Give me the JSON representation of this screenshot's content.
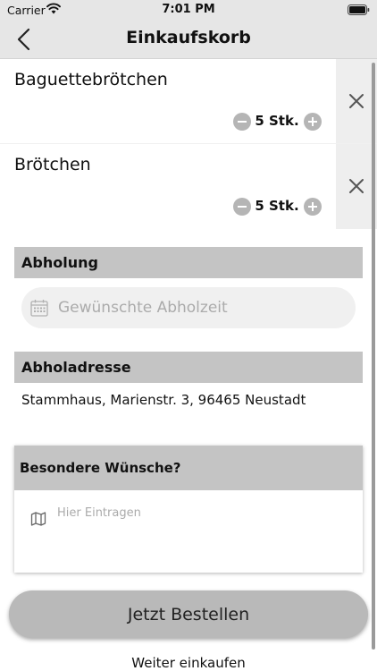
{
  "status_bar": {
    "carrier": "Carrier",
    "time": "7:01 PM"
  },
  "nav": {
    "title": "Einkaufskorb"
  },
  "cart": {
    "items": [
      {
        "name": "Baguettebrötchen",
        "quantity": "5 Stk."
      },
      {
        "name": "Brötchen",
        "quantity": "5 Stk."
      }
    ]
  },
  "pickup": {
    "header": "Abholung",
    "placeholder": "Gewünschte Abholzeit"
  },
  "address": {
    "header": "Abholadresse",
    "value": "Stammhaus, Marienstr. 3, 96465 Neustadt"
  },
  "wishes": {
    "header": "Besondere Wünsche?",
    "placeholder": "Hier Eintragen"
  },
  "actions": {
    "order_label": "Jetzt Bestellen",
    "continue_label": "Weiter einkaufen"
  },
  "icons": {
    "wifi": "wifi-icon",
    "battery": "battery-icon",
    "back": "chevron-left-icon",
    "minus": "minus-circle-icon",
    "plus": "plus-circle-icon",
    "delete": "close-icon",
    "calendar": "calendar-icon",
    "map": "map-icon"
  },
  "colors": {
    "bar_background": "#e6e6e6",
    "section_header": "#c4c4c4",
    "button": "#b9b9b9",
    "field_background": "#f0f0f0"
  }
}
